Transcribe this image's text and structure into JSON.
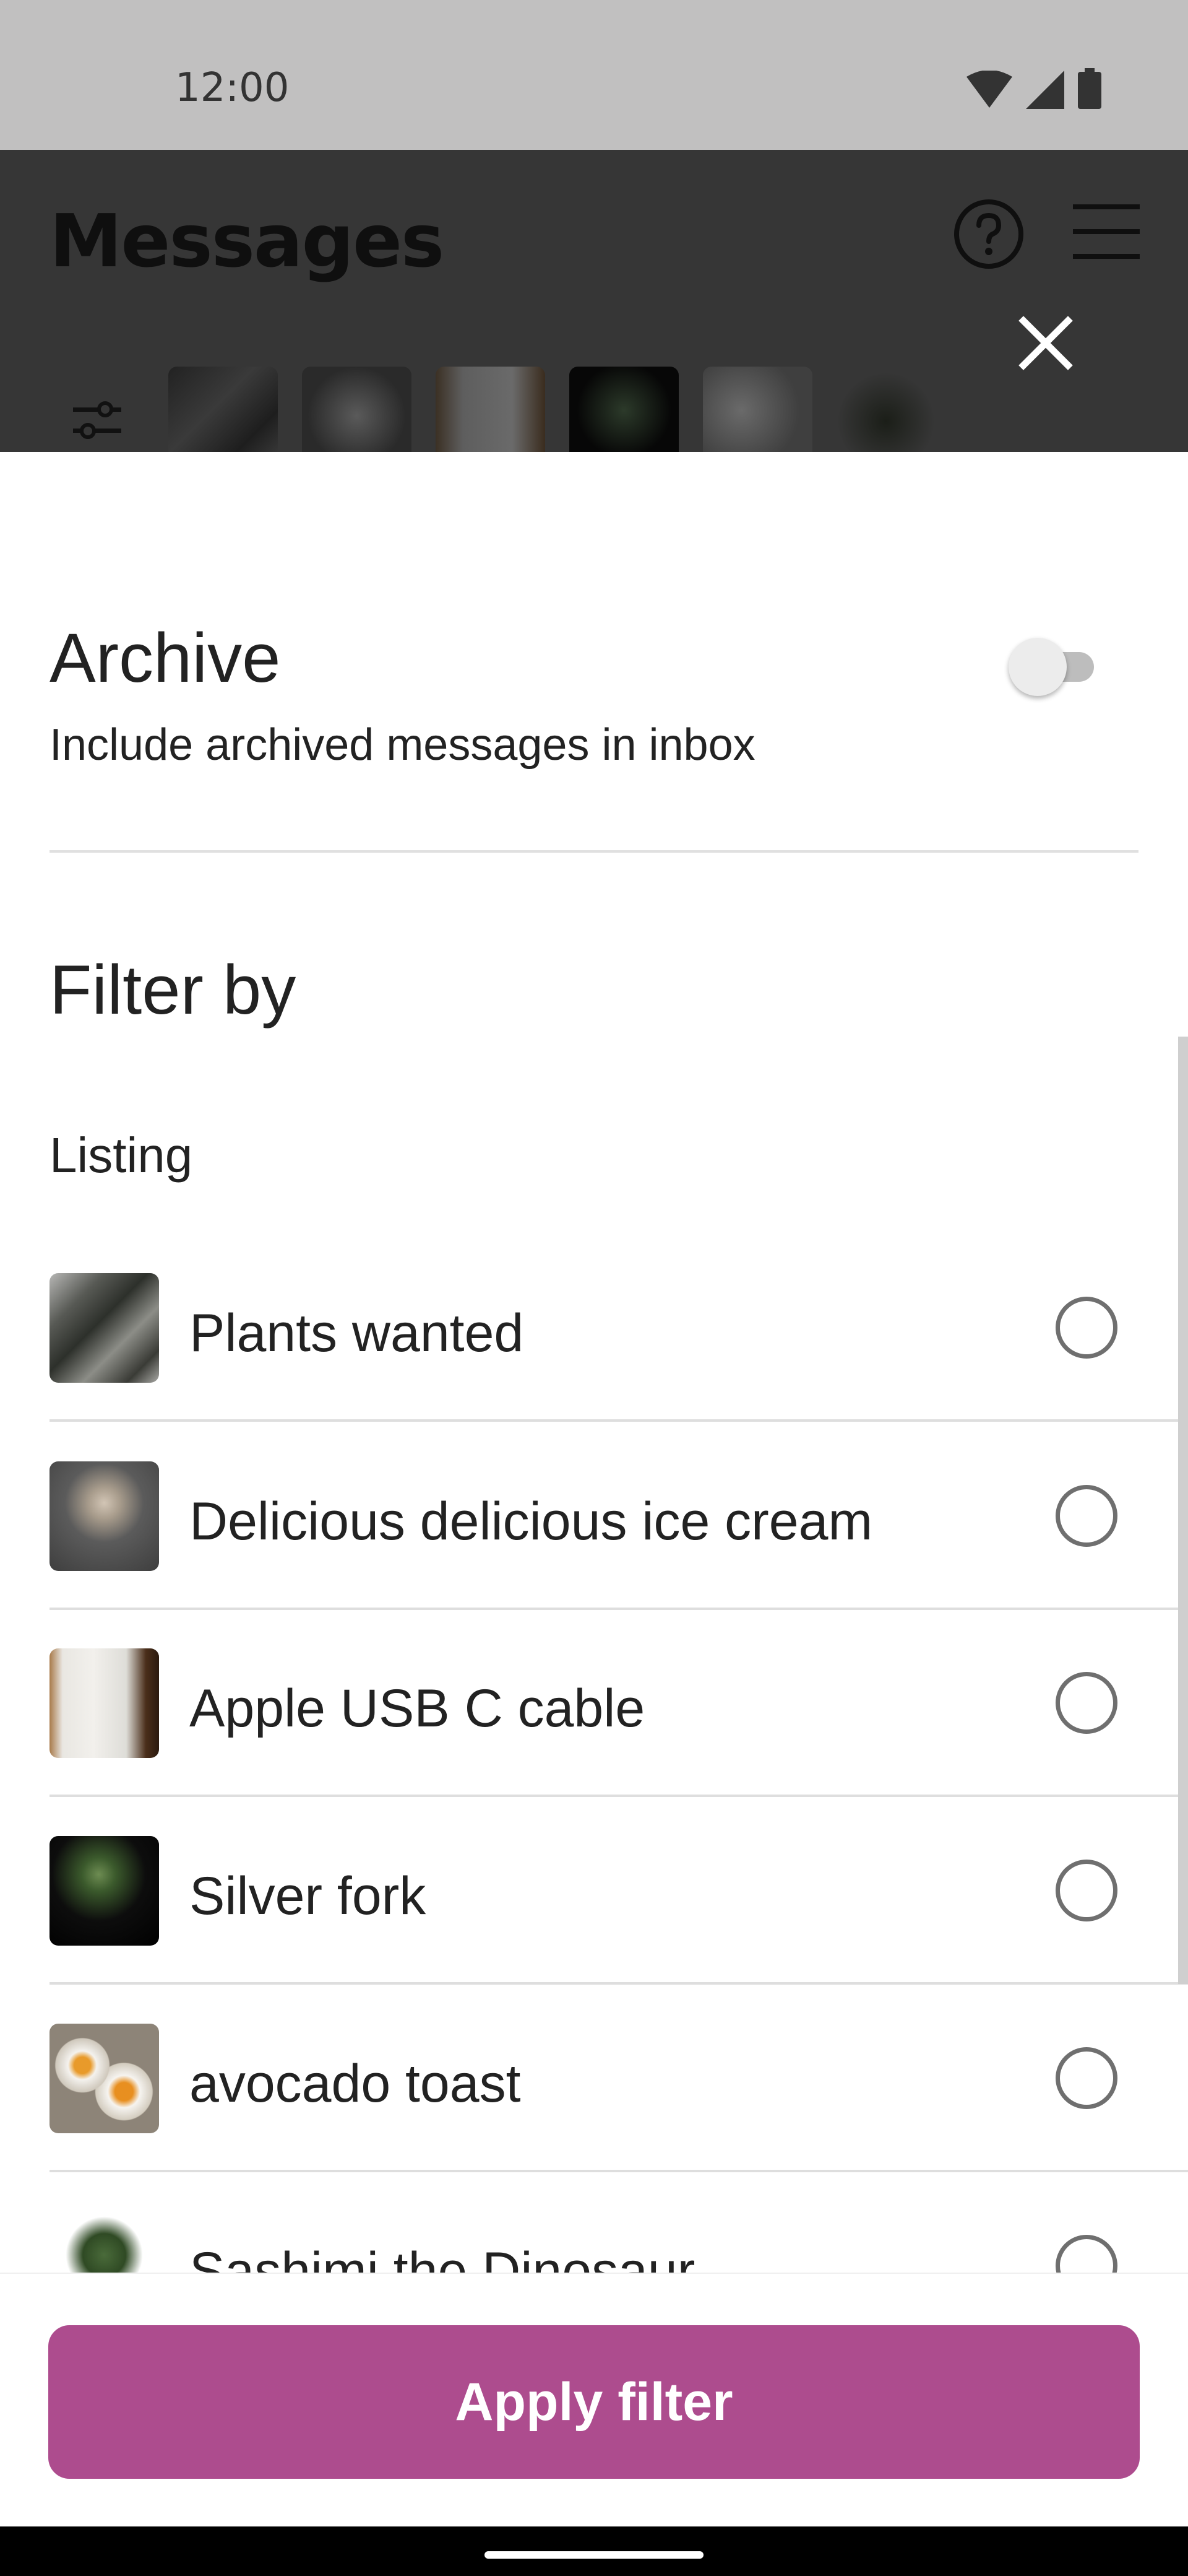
{
  "status_bar": {
    "time": "12:00",
    "icons": [
      "wifi-icon",
      "cellular-signal-icon",
      "battery-icon"
    ]
  },
  "header": {
    "title": "Messages",
    "help_icon": "help-circle-icon",
    "menu_icon": "hamburger-menu-icon",
    "close_icon": "close-icon",
    "filter_icon": "sliders-icon"
  },
  "archive": {
    "title": "Archive",
    "subtitle": "Include archived messages in inbox",
    "toggle_on": false
  },
  "filter": {
    "title": "Filter by",
    "section_label": "Listing",
    "listings": [
      {
        "label": "Plants wanted",
        "selected": false
      },
      {
        "label": "Delicious delicious ice cream",
        "selected": false
      },
      {
        "label": "Apple USB C cable",
        "selected": false
      },
      {
        "label": "Silver fork",
        "selected": false
      },
      {
        "label": "avocado toast",
        "selected": false
      },
      {
        "label": "Sashimi the Dinosaur",
        "selected": false
      }
    ]
  },
  "apply_button": {
    "label": "Apply filter"
  },
  "colors": {
    "accent": "#ad4c8e",
    "header_overlay": "#363636",
    "status_bar": "#c1c0c0"
  }
}
